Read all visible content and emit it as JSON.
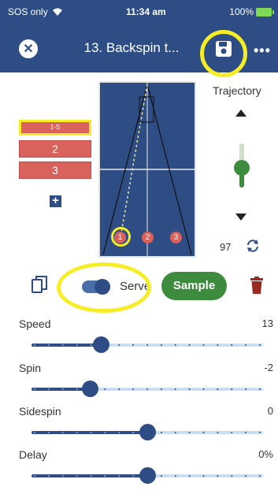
{
  "status_bar": {
    "carrier": "SOS only",
    "time": "11:34 am",
    "battery": "100%"
  },
  "header": {
    "title": "13. Backspin t...",
    "close_icon": "close-icon",
    "save_icon": "save-icon",
    "more_icon": "more-horizontal-icon",
    "more_label": "•••"
  },
  "sequence": {
    "items": [
      {
        "label": "1-S",
        "selected": true
      },
      {
        "label": "2",
        "selected": false
      },
      {
        "label": "3",
        "selected": false
      }
    ],
    "add_label": "+"
  },
  "table": {
    "balls": [
      "1",
      "2",
      "3"
    ],
    "selected_ball": "1"
  },
  "trajectory": {
    "label": "Trajectory",
    "value": "97",
    "level": 0.45
  },
  "controls": {
    "serve_label": "Serve",
    "serve_on": true,
    "sample_label": "Sample"
  },
  "sliders": [
    {
      "label": "Speed",
      "value": "13",
      "fraction": 0.3
    },
    {
      "label": "Spin",
      "value": "-2",
      "fraction": 0.25
    },
    {
      "label": "Sidespin",
      "value": "0",
      "fraction": 0.5
    },
    {
      "label": "Delay",
      "value": "0%",
      "fraction": 0.5
    }
  ],
  "colors": {
    "primary": "#2e4d85",
    "green": "#3d8b3d",
    "red": "#d9625d",
    "highlight": "#f5ee26",
    "trash": "#9a2a24"
  }
}
